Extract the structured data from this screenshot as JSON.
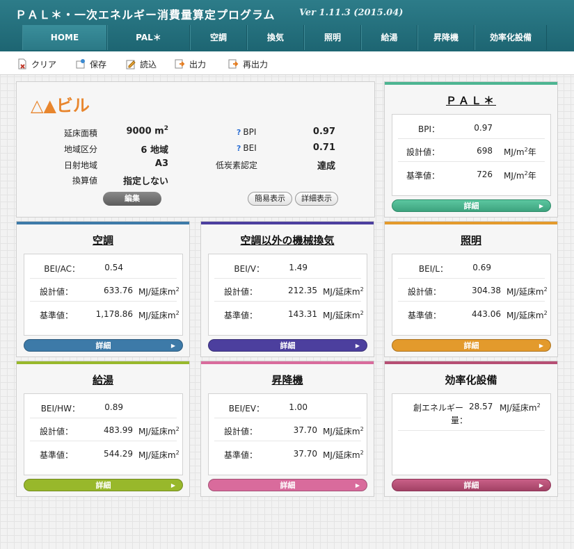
{
  "app": {
    "title": "ＰＡＬ＊・一次エネルギー消費量算定プログラム",
    "version": "Ver 1.11.3 (2015.04)"
  },
  "nav": [
    "HOME",
    "PAL＊",
    "空調",
    "換気",
    "照明",
    "給湯",
    "昇降機",
    "効率化設備"
  ],
  "toolbar": {
    "clear": "クリア",
    "save": "保存",
    "load": "読込",
    "output": "出力",
    "reoutput": "再出力"
  },
  "building": {
    "name": "△▲ビル",
    "floor_area_label": "延床面積",
    "floor_area_value": "9000 m",
    "floor_area_sup": "2",
    "region_label": "地域区分",
    "region_value": "6 地域",
    "solar_label": "日射地域",
    "solar_value": "A3",
    "conv_label": "換算値",
    "conv_value": "指定しない",
    "bpi_label": "BPI",
    "bpi_value": "0.97",
    "bei_label": "BEI",
    "bei_value": "0.71",
    "lowcarbon_label": "低炭素認定",
    "lowcarbon_value": "達成",
    "qmark": "?",
    "edit_button": "編集",
    "simple_view": "簡易表示",
    "detail_view": "詳細表示"
  },
  "common": {
    "design_label": "設計値：",
    "standard_label": "基準値：",
    "detail": "詳細",
    "arrow": "▶",
    "unit_pal_prefix": "MJ/m",
    "unit_pal_suffix": "年",
    "unit_prefix": "MJ/延床m",
    "sup": "2"
  },
  "pal": {
    "title": "ＰＡＬ＊",
    "index_label": "BPI：",
    "index_value": "0.97",
    "design_value": "698",
    "standard_value": "726"
  },
  "panels": [
    {
      "key": "ac",
      "title": "空調",
      "index_label": "BEI/AC：",
      "index_value": "0.54",
      "design_value": "633.76",
      "standard_value": "1,178.86",
      "color": "#3d7aa8"
    },
    {
      "key": "v",
      "title": "空調以外の機械換気",
      "index_label": "BEI/V：",
      "index_value": "1.49",
      "design_value": "212.35",
      "standard_value": "143.31",
      "color": "#4c3f9e"
    },
    {
      "key": "l",
      "title": "照明",
      "index_label": "BEI/L：",
      "index_value": "0.69",
      "design_value": "304.38",
      "standard_value": "443.06",
      "color": "#e39a2c"
    },
    {
      "key": "hw",
      "title": "給湯",
      "index_label": "BEI/HW：",
      "index_value": "0.89",
      "design_value": "483.99",
      "standard_value": "544.29",
      "color": "#98b82b"
    },
    {
      "key": "ev",
      "title": "昇降機",
      "index_label": "BEI/EV：",
      "index_value": "1.00",
      "design_value": "37.70",
      "standard_value": "37.70",
      "color": "#d96b9c"
    }
  ],
  "efficiency": {
    "title": "効率化設備",
    "label_line1": "創エネルギー",
    "label_line2": "量：",
    "value": "28.57",
    "color": "#b64f74"
  },
  "colors": {
    "header": "#1d6572",
    "pal_accent": "#4db592",
    "building_name": "#e8862e"
  }
}
